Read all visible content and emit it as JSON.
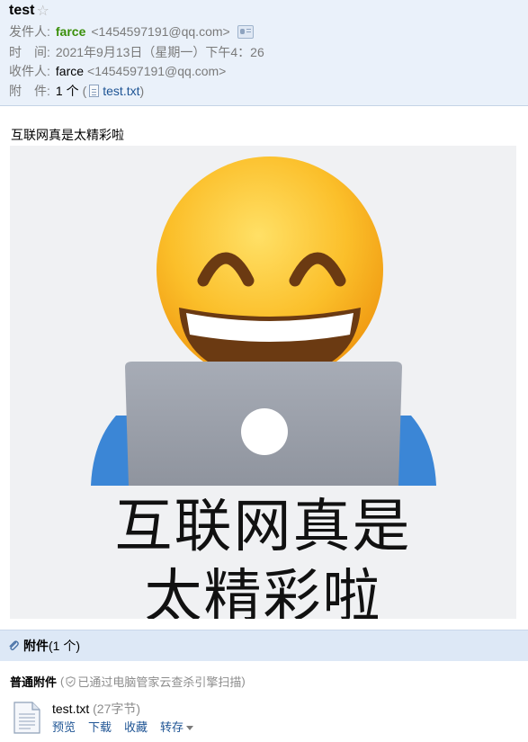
{
  "header": {
    "subject": "test",
    "from_label": "发件人:",
    "from_name": "farce",
    "from_email": "<1454597191@qq.com>",
    "time_label": "时　间:",
    "time_value": "2021年9月13日（星期一）下午4：26",
    "to_label": "收件人:",
    "to_name": "farce",
    "to_email": "<1454597191@qq.com>",
    "attach_label": "附　件:",
    "attach_count": "1 个",
    "attach_paren_open": "(",
    "attach_file": "test.txt",
    "attach_paren_close": ")"
  },
  "body": {
    "text": "互联网真是太精彩啦",
    "meme_line1": "互联网真是",
    "meme_line2": "太精彩啦"
  },
  "attachments": {
    "title": "附件",
    "count": "(1 个)",
    "section_title": "普通附件",
    "scan_open": "(",
    "scan_note": "已通过电脑管家云查杀引擎扫描",
    "scan_close": ")",
    "file": {
      "name": "test.txt",
      "size": "(27字节)",
      "actions": [
        "预览",
        "下载",
        "收藏",
        "转存"
      ]
    }
  },
  "icons": [
    "star-icon",
    "contact-card-icon",
    "file-icon",
    "paperclip-icon",
    "shield-icon",
    "document-icon",
    "caret-down-icon"
  ],
  "colors": {
    "sender": "#3a8f0a",
    "link": "#1e5494",
    "header_bg": "#eaf1fa",
    "attach_bar_bg": "#dde8f6"
  }
}
